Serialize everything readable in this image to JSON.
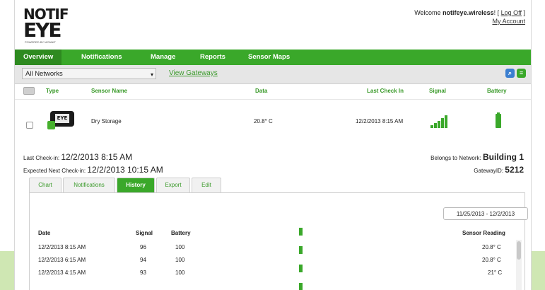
{
  "logo": {
    "line1": "NOTIF",
    "line2": "EYE",
    "tagline": "POWERED BY MONNIT"
  },
  "header": {
    "welcome_prefix": "Welcome ",
    "username": "notifeye.wireless",
    "logoff_label": "Log Off",
    "my_account_label": "My Account"
  },
  "nav": [
    {
      "label": "Overview",
      "active": true
    },
    {
      "label": "Notifications",
      "active": false
    },
    {
      "label": "Manage",
      "active": false
    },
    {
      "label": "Reports",
      "active": false
    },
    {
      "label": "Sensor Maps",
      "active": false
    }
  ],
  "toolbar": {
    "network_select": "All Networks",
    "view_gateways_label": "View Gateways",
    "search_icon": "search-icon",
    "export_icon": "export-icon"
  },
  "sensor_table": {
    "headers": {
      "type": "Type",
      "name": "Sensor Name",
      "data": "Data",
      "last_check_in": "Last Check In",
      "signal": "Signal",
      "battery": "Battery"
    },
    "row": {
      "name": "Dry Storage",
      "data": "20.8° C",
      "last_check_in": "12/2/2013 8:15 AM",
      "device_label": "EYE",
      "signal_bars": 5,
      "battery_level": 1.0
    }
  },
  "details": {
    "last_check_in_label": "Last Check-in:",
    "last_check_in_value": "12/2/2013 8:15 AM",
    "next_check_in_label": "Expected Next Check-in:",
    "next_check_in_value": "12/2/2013 10:15 AM",
    "network_label": "Belongs to Network:",
    "network_value": "Building 1",
    "gateway_label": "GatewayID:",
    "gateway_value": "5212"
  },
  "tabs": [
    {
      "label": "Chart",
      "active": false
    },
    {
      "label": "Notifications",
      "active": false
    },
    {
      "label": "History",
      "active": true
    },
    {
      "label": "Export",
      "active": false
    },
    {
      "label": "Edit",
      "active": false
    }
  ],
  "history": {
    "date_range": "11/25/2013 - 12/2/2013",
    "headers": {
      "date": "Date",
      "signal": "Signal",
      "battery": "Battery",
      "reading": "Sensor Reading"
    },
    "rows": [
      {
        "date": "12/2/2013 8:15 AM",
        "signal": "96",
        "battery": "100",
        "reading": "20.8° C"
      },
      {
        "date": "12/2/2013 6:15 AM",
        "signal": "94",
        "battery": "100",
        "reading": "20.8° C"
      },
      {
        "date": "12/2/2013 4:15 AM",
        "signal": "93",
        "battery": "100",
        "reading": "21° C"
      }
    ]
  },
  "colors": {
    "brand_green": "#3aa82a",
    "nav_active": "#2e8a20",
    "toolbar_bg": "#e6e6e6"
  }
}
